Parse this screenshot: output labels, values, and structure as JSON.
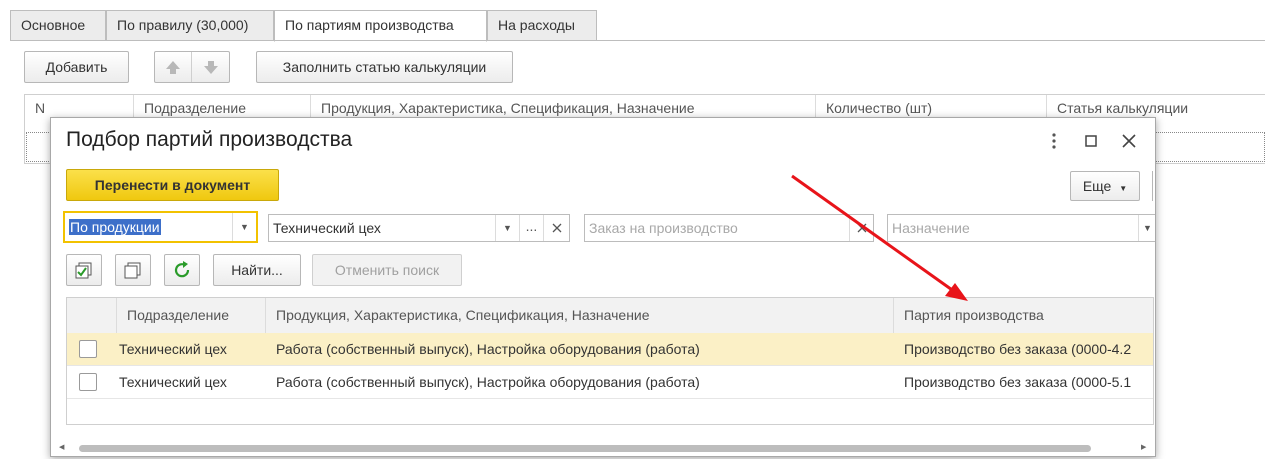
{
  "tabs": [
    {
      "label": "Основное"
    },
    {
      "label": "По правилу (30,000)"
    },
    {
      "label": "По партиям производства"
    },
    {
      "label": "На расходы"
    }
  ],
  "toolbar": {
    "add_label": "Добавить",
    "fill_label": "Заполнить статью калькуляции"
  },
  "main_table": {
    "columns": [
      "N",
      "Подразделение",
      "Продукция, Характеристика, Спецификация, Назначение",
      "Количество (шт)",
      "Статья калькуляции"
    ]
  },
  "dialog": {
    "title": "Подбор партий производства",
    "transfer_label": "Перенести в документ",
    "more_label": "Еще",
    "filters": {
      "mode_value": "По продукции",
      "division_value": "Технический цех",
      "order_placeholder": "Заказ на производство",
      "purpose_placeholder": "Назначение",
      "dots_label": "..."
    },
    "find_label": "Найти...",
    "cancel_search_label": "Отменить поиск",
    "grid": {
      "columns": [
        "Подразделение",
        "Продукция, Характеристика, Спецификация, Назначение",
        "Партия производства"
      ],
      "rows": [
        {
          "division": "Технический цех",
          "product": "Работа (собственный выпуск), Настройка оборудования (работа)",
          "batch": "Производство без заказа (0000-4.2"
        },
        {
          "division": "Технический цех",
          "product": "Работа (собственный выпуск), Настройка оборудования (работа)",
          "batch": "Производство без заказа (0000-5.1"
        }
      ]
    }
  },
  "colors": {
    "accent_yellow": "#f5d11e",
    "selected_row": "#fbf0c6",
    "focus_border": "#f2c200",
    "arrow": "#e8141a",
    "refresh_green": "#2a9b2a"
  }
}
